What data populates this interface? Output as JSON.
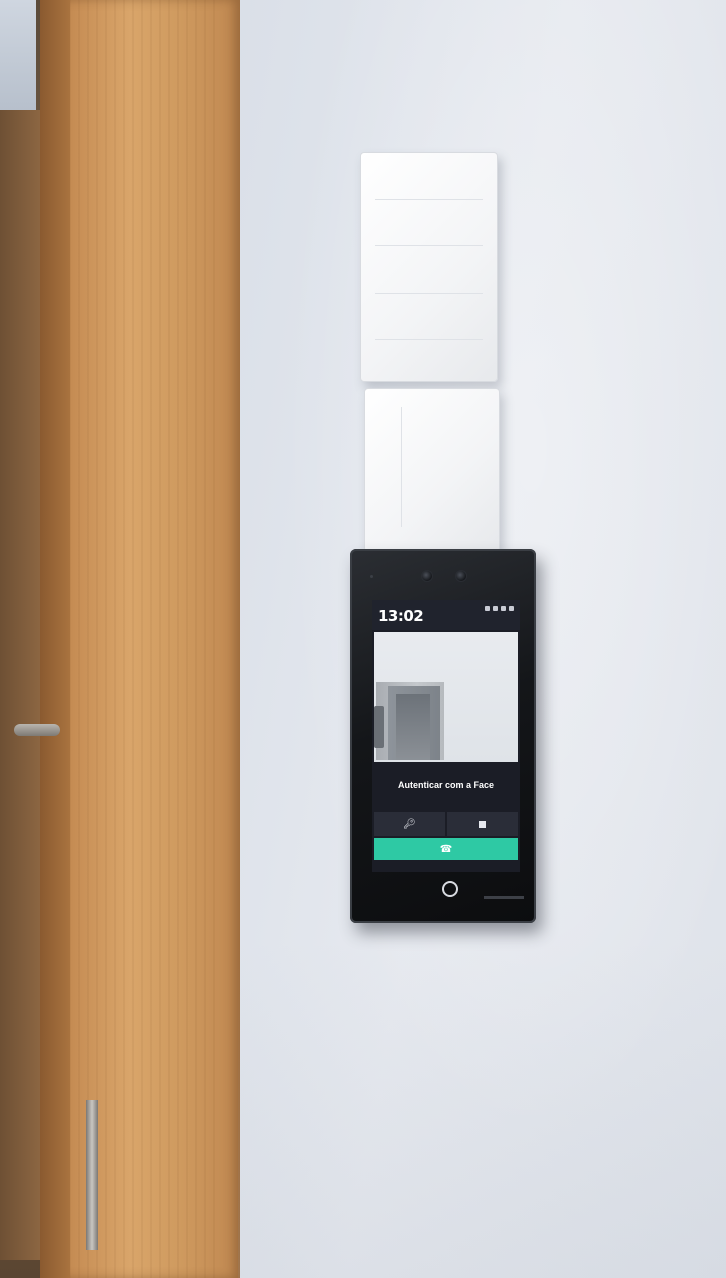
{
  "device_screen": {
    "time": "13:02",
    "auth_prompt": "Autenticar com a Face",
    "icons": {
      "key_button": "key-icon",
      "qr_button": "qr-code-icon",
      "call_button": "phone-icon",
      "home_button": "home-ring-icon"
    },
    "colors": {
      "call_button": "#2ec9a4",
      "screen_background": "#1b1d26"
    }
  }
}
